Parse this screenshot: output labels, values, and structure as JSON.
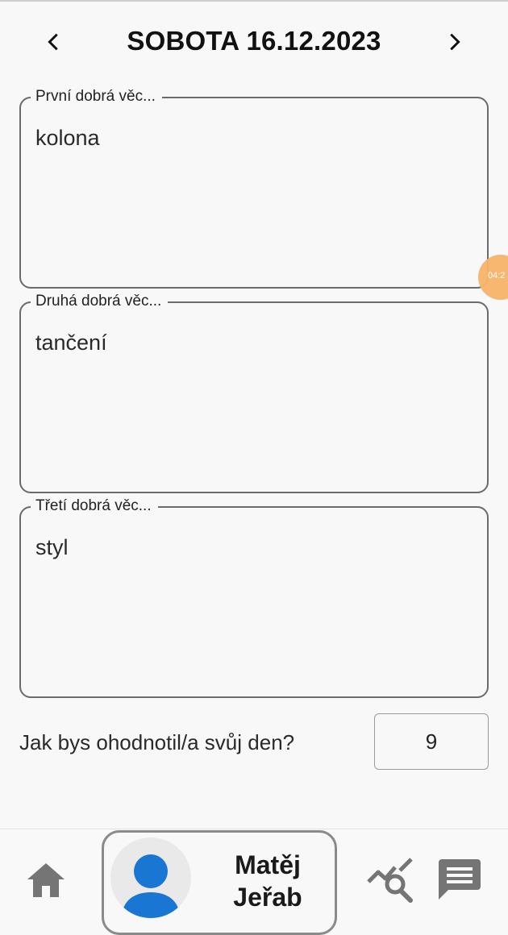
{
  "header": {
    "title": "SOBOTA 16.12.2023",
    "prev_icon": "chevron-left-icon",
    "next_icon": "chevron-right-icon"
  },
  "fields": [
    {
      "label": "První dobrá věc...",
      "value": "kolona"
    },
    {
      "label": "Druhá dobrá věc...",
      "value": "tančení"
    },
    {
      "label": "Třetí dobrá věc...",
      "value": "styl"
    }
  ],
  "floating_badge": {
    "text": "04:2"
  },
  "rating": {
    "question": "Jak bys ohodnotil/a svůj den?",
    "value": "9"
  },
  "bottom_nav": {
    "home_icon": "home-icon",
    "profile": {
      "first_name": "Matěj",
      "last_name": "Jeřab",
      "avatar_icon": "person-icon"
    },
    "stats_icon": "chart-search-icon",
    "chat_icon": "chat-icon"
  },
  "colors": {
    "background": "#f8f8f8",
    "accent_blue": "#1976d2",
    "icon_gray": "#757575",
    "badge_orange": "#f7b46a"
  }
}
